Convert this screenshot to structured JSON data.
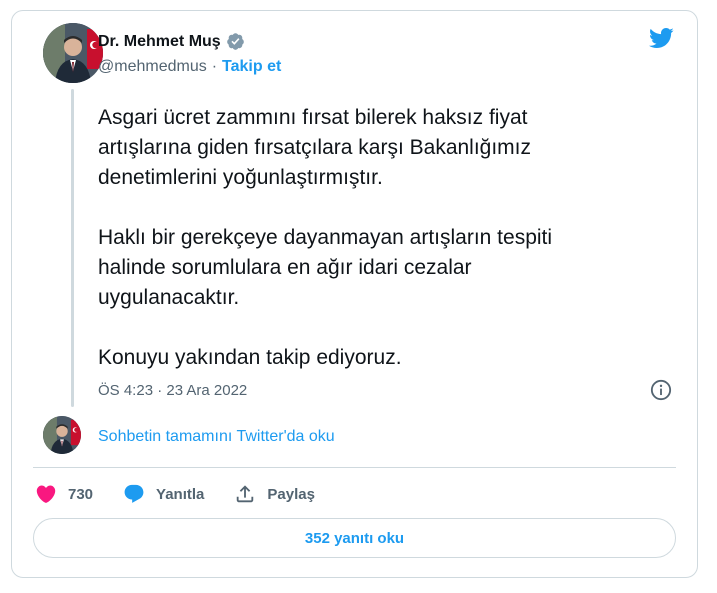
{
  "author": {
    "display_name": "Dr. Mehmet Muş",
    "handle": "@mehmedmus",
    "separator": "·",
    "follow_label": "Takip et",
    "verified": true
  },
  "tweet": {
    "text": "Asgari ücret zammını fırsat bilerek haksız fiyat\nartışlarına giden fırsatçılara karşı Bakanlığımız\ndenetimlerini yoğunlaştırmıştır.\n\nHaklı bir gerekçeye dayanmayan artışların tespiti\nhalinde sorumlulara en ağır idari cezalar\nuygulanacaktır.\n\nKonuyu yakından takip ediyoruz.",
    "timestamp": "ÖS 4:23 · 23 Ara 2022"
  },
  "thread_link": "Sohbetin tamamını Twitter'da oku",
  "actions": {
    "like_count": "730",
    "reply_label": "Yanıtla",
    "share_label": "Paylaş"
  },
  "read_replies_label": "352 yanıtı oku",
  "icons": {
    "brand": "twitter-bird-icon",
    "verified": "verified-badge-icon",
    "info": "info-icon",
    "like": "heart-icon",
    "reply": "reply-bubble-icon",
    "share": "share-icon"
  },
  "colors": {
    "accent": "#1d9bf0",
    "like": "#f91880",
    "muted": "#536471",
    "border": "#cfd9de",
    "verified_badge": "#829aab"
  }
}
